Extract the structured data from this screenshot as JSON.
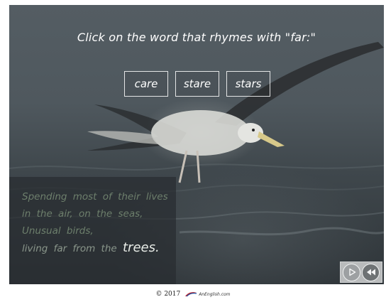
{
  "quiz": {
    "question": "Click on the word that rhymes with \"far:\"",
    "answers": [
      "care",
      "stare",
      "stars"
    ]
  },
  "poem": {
    "lines": [
      "Spending most of their lives",
      "in the air, on the seas,",
      "Unusual birds,"
    ],
    "last_line_prefix": "living far from the",
    "last_line_highlight": "trees."
  },
  "controls": {
    "play_icon": "play-icon",
    "rewind_icon": "rewind-icon"
  },
  "footer": {
    "copyright": "© 2017",
    "logo_text": "AnEnglish.com"
  },
  "colors": {
    "background_dark": "#3f474c",
    "text_white": "#ffffff",
    "poem_text": "#6d7f6c",
    "nav_panel": "#b9bbbc"
  }
}
